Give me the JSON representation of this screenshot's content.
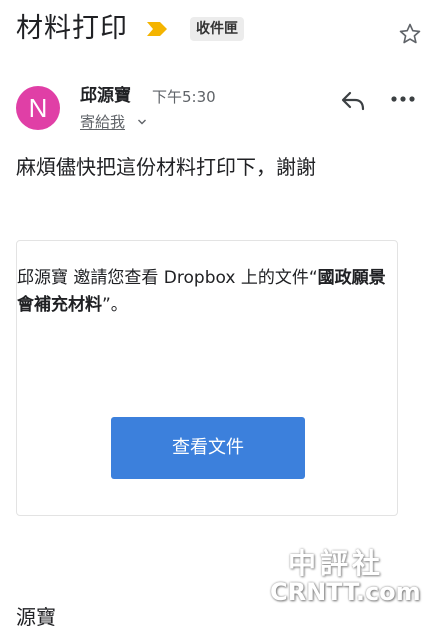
{
  "email": {
    "subject": "材料打印",
    "label": "收件匣",
    "sender_initial": "N",
    "sender_name": "邱源寶",
    "time": "下午5:30",
    "recipient": "寄給我",
    "body": "麻煩儘快把這份材料打印下，謝謝",
    "signature": "源寶"
  },
  "card": {
    "text_before": "邱源寶 邀請您查看 Dropbox 上的文件“",
    "doc_name": "國政願景會補充材料",
    "text_after": "”。",
    "button_label": "查看文件"
  },
  "watermark": {
    "top": "中評社",
    "bottom": "CRNTT.com"
  },
  "colors": {
    "avatar": "#e03fa6",
    "button": "#3c80dc",
    "importance": "#f4b400"
  },
  "icons": {
    "importance": "importance-marker-icon",
    "star": "star-icon",
    "reply": "reply-icon",
    "more": "more-icon",
    "chevron": "chevron-down-icon"
  }
}
